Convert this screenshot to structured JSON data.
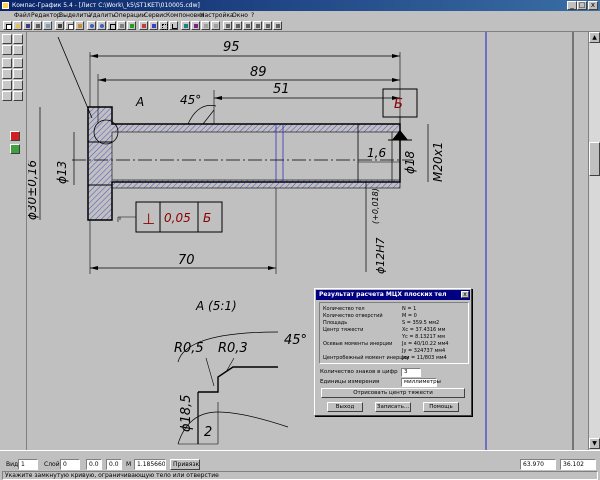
{
  "window": {
    "title": "Компас-График 5.4 - [Лист C:\\Work\\_k5\\ST1KET\\010005.cdw]",
    "controls": [
      "_",
      "□",
      "x"
    ]
  },
  "menu": [
    "Файл",
    "Редактор",
    "Выделить",
    "Удалить",
    "Операции",
    "Сервис",
    "Компоновка",
    "Настройка",
    "Окно",
    "?"
  ],
  "drawing": {
    "dims": {
      "d95": "95",
      "d89": "89",
      "d51": "51",
      "d45": "45°",
      "d70": "70",
      "d13": "ϕ13",
      "d30": "ϕ30±0,16",
      "d18": "ϕ18",
      "m20": "M20x1",
      "d16": "1,6",
      "d12h7": "ϕ12H7",
      "tol": "(+0,018)",
      "r05": "R0,5",
      "r03": "R0,3",
      "a45": "45°",
      "d185": "ϕ18,5",
      "w2": "2"
    },
    "labels": {
      "a": "A",
      "base": "Б",
      "detail": "A  (5:1)"
    },
    "tolerance_frame": {
      "symbol": "⊥",
      "value": "0,05",
      "base": "Б"
    }
  },
  "dialog": {
    "title": "Результат расчета МЦХ плоских тел",
    "close": "x",
    "rows": [
      {
        "label": "Количество тел",
        "value": "N = 1"
      },
      {
        "label": "Количество отверстий",
        "value": "M = 0"
      },
      {
        "label": "Площадь",
        "value": "S = 359.5 мм2"
      },
      {
        "label": "Центр тяжести",
        "value": "Xc = 37.4316 мм"
      },
      {
        "label": "",
        "value": "Yc = 8.13217 мм"
      },
      {
        "label": "Осевые моменты инерции",
        "value": "Jx = 40/10.22 мм4"
      },
      {
        "label": "",
        "value": "Jy = 324737 мм4"
      },
      {
        "label": "Центробежный момент инерции",
        "value": "Jxy = 11/803 мм4"
      }
    ],
    "digits_label": "Количество знаков в цифр",
    "digits_value": "3",
    "units_label": "Единицы измерения",
    "units_value": "миллиметры",
    "draw_center_btn": "Отрисовать центр тяжести",
    "exit_btn": "Выход",
    "save_btn": "Записать...",
    "help_btn": "Помощь"
  },
  "statusbar": {
    "layer_label": "Вид",
    "layer_value": "1",
    "step_label": "Слой",
    "step_value": "0",
    "x_value": "0.0",
    "y_value": "0.0",
    "m_label": "M",
    "scale_value": "1.185660",
    "mode_btn": "Привязки",
    "coord_x": "63.970",
    "coord_y": "36.102",
    "hint": "Укажите замкнутую кривую, ограничивающую тело или отверстие"
  },
  "colors": {
    "titlebar": "#0a246a",
    "dialog_title": "#000080",
    "drawing_line": "#000000",
    "hatch": "#3333cc",
    "frame_text": "#8b0000"
  }
}
